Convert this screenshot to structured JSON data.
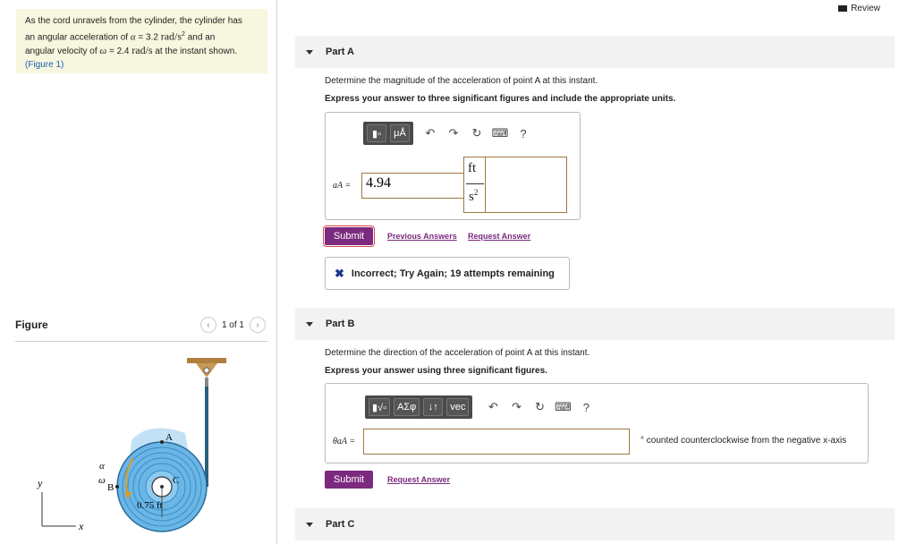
{
  "problem": {
    "text1": "As the cord unravels from the cylinder, the cylinder has",
    "text2a": "an angular acceleration of ",
    "alpha_sym": "α",
    "text2b": " = 3.2 ",
    "unit_alpha": "rad/s",
    "text2c": " and an",
    "text3a": "angular velocity of ",
    "omega_sym": "ω",
    "text3b": " = 2.4 ",
    "unit_omega": "rad/s",
    "text3c": " at the instant shown.",
    "figure_link": "(Figure 1)"
  },
  "review": "Review",
  "figure": {
    "title": "Figure",
    "pager": "1 of 1",
    "label_alpha": "α",
    "label_omega": "ω",
    "label_A": "A",
    "label_B": "B",
    "label_C": "C",
    "label_y": "y",
    "label_x": "x",
    "dimension": "0.75 ft"
  },
  "partA": {
    "title": "Part A",
    "prompt": "Determine the magnitude of the acceleration of point A at this instant.",
    "instruction": "Express your answer to three significant figures and include the appropriate units.",
    "var": "aA =",
    "value": "4.94",
    "unit_num": "ft",
    "unit_den": "s",
    "unit_den_exp": "2",
    "submit": "Submit",
    "previous": "Previous Answers",
    "request": "Request Answer",
    "feedback": "Incorrect; Try Again; 19 attempts remaining",
    "toolbar": {
      "mu": "μÅ",
      "help": "?"
    }
  },
  "partB": {
    "title": "Part B",
    "prompt": "Determine the direction of the acceleration of point A at this instant.",
    "instruction": "Express your answer using three significant figures.",
    "var": "θaA =",
    "value": "",
    "note": "° counted counterclockwise from the negative x-axis",
    "submit": "Submit",
    "request": "Request Answer",
    "toolbar": {
      "sym": "ΑΣφ",
      "arrows": "↓↑",
      "vec": "vec",
      "help": "?"
    }
  },
  "partC": {
    "title": "Part C"
  }
}
